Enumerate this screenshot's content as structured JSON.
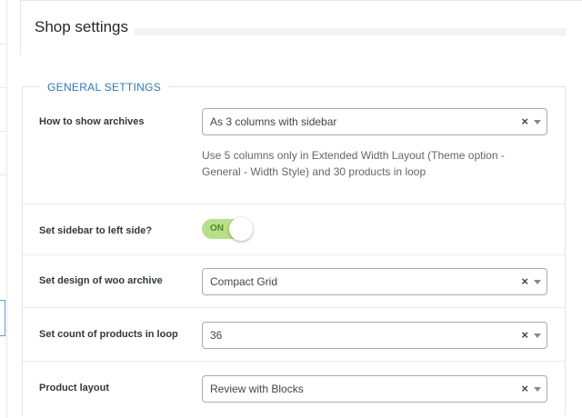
{
  "header": {
    "title": "Shop settings"
  },
  "section": {
    "legend": "GENERAL SETTINGS"
  },
  "rows": {
    "archives": {
      "label": "How to show archives",
      "value": "As 3 columns with sidebar",
      "description": "Use 5 columns only in Extended Width Layout (Theme option - General - Width Style) and 30 products in loop"
    },
    "sidebar_left": {
      "label": "Set sidebar to left side?",
      "toggle_text": "ON"
    },
    "design": {
      "label": "Set design of woo archive",
      "value": "Compact Grid"
    },
    "count": {
      "label": "Set count of products in loop",
      "value": "36"
    },
    "layout": {
      "label": "Product layout",
      "value": "Review with Blocks"
    }
  },
  "select_clear_glyph": "×",
  "colors": {
    "accent": "#2b7ab8",
    "toggle_on": "#b8e08a"
  }
}
